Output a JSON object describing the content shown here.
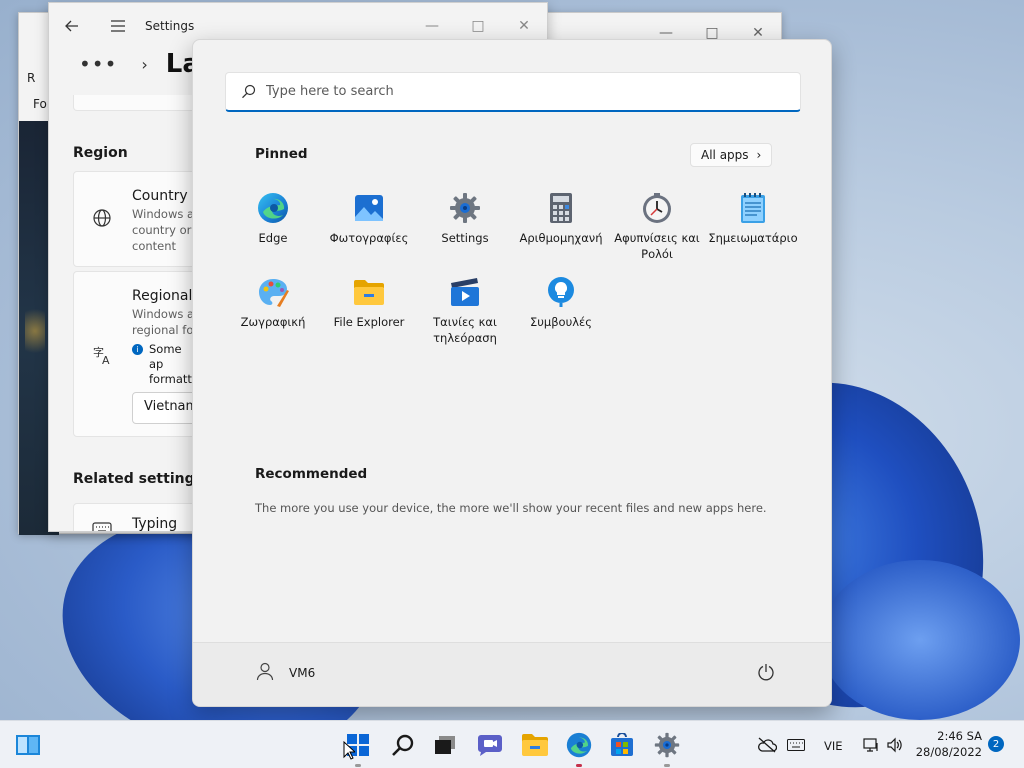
{
  "settings_window": {
    "title": "Settings",
    "breadcrumb_current": "Lan",
    "region_heading": "Region",
    "country_title": "Country o",
    "country_desc": "Windows a country or content",
    "regional_title": "Regional f",
    "regional_desc": "Windows a regional for",
    "info_text": "Some ap formatti",
    "regional_value": "Vietnam",
    "related_heading": "Related settings",
    "typing_label": "Typing"
  },
  "back_window": {
    "side_label": "For",
    "letter": "R"
  },
  "start_menu": {
    "search_placeholder": "Type here to search",
    "pinned_heading": "Pinned",
    "all_apps_label": "All apps",
    "pinned_apps": [
      {
        "label": "Edge",
        "icon": "edge-icon"
      },
      {
        "label": "Φωτογραφίες",
        "icon": "photos-icon"
      },
      {
        "label": "Settings",
        "icon": "settings-gear-icon"
      },
      {
        "label": "Αριθμομηχανή",
        "icon": "calculator-icon"
      },
      {
        "label": "Αφυπνίσεις και Ρολόι",
        "icon": "alarm-clock-icon"
      },
      {
        "label": "Σημειωματάριο",
        "icon": "notepad-icon"
      },
      {
        "label": "Ζωγραφική",
        "icon": "paint-icon"
      },
      {
        "label": "File Explorer",
        "icon": "folder-icon"
      },
      {
        "label": "Ταινίες και τηλεόραση",
        "icon": "movies-tv-icon"
      },
      {
        "label": "Συμβουλές",
        "icon": "tips-lightbulb-icon"
      }
    ],
    "recommended_heading": "Recommended",
    "recommended_text": "The more you use your device, the more we'll show your recent files and new apps here.",
    "user_name": "VM6"
  },
  "taskbar": {
    "language": "VIE",
    "time": "2:46 SA",
    "date": "28/08/2022",
    "notification_count": "2"
  },
  "colors": {
    "accent": "#0067c0",
    "edge_running": "#c4314b"
  }
}
